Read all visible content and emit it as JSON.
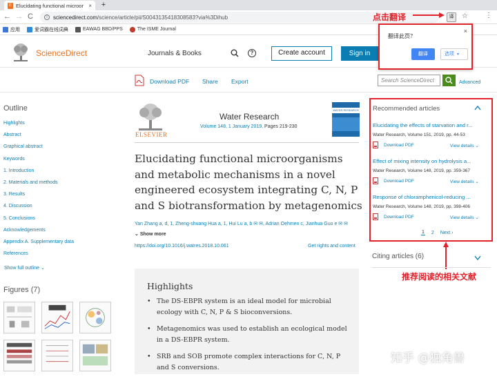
{
  "browser": {
    "tab_title": "Elucidating functional microor",
    "tab_close": "×",
    "new_tab": "+",
    "back": "←",
    "forward": "→",
    "reload": "C",
    "url_domain": "sciencedirect.com",
    "url_path": "/science/article/pii/S0043135418308583?via%3Dihub",
    "translate_icon": "译",
    "star": "☆",
    "menu": "⋮",
    "bookmarks": [
      {
        "label": "应用",
        "color": "#3c78d8"
      },
      {
        "label": "爱词霸在线词典",
        "color": "#2e8bdb"
      },
      {
        "label": "EAWAG BBD/PPS",
        "color": "#555555"
      },
      {
        "label": "The ISME Journal",
        "color": "#c0392b"
      }
    ]
  },
  "translate_popup": {
    "title": "翻译此页？",
    "close": "×",
    "translate_button": "翻译",
    "options_button": "选项"
  },
  "annotations": {
    "click_translate": "点击翻译",
    "recommended_note": "推荐阅读的相关文献",
    "watermark": "知乎 @独角兽"
  },
  "header": {
    "logo": "ScienceDirect",
    "journals_books": "Journals & Books",
    "create_account": "Create account",
    "sign_in": "Sign in"
  },
  "toolbar": {
    "download_pdf": "Download PDF",
    "share": "Share",
    "export": "Export",
    "search_placeholder": "Search ScienceDirect",
    "advanced": "Advanced"
  },
  "outline": {
    "title": "Outline",
    "items": [
      "Highlights",
      "Abstract",
      "Graphical abstract",
      "Keywords",
      "1. Introduction",
      "2. Materials and methods",
      "3. Results",
      "4. Discussion",
      "5. Conclusions",
      "Acknowledgements",
      "Appendix A. Supplementary data",
      "References"
    ],
    "show_full": "Show full outline",
    "figures_title": "Figures (7)"
  },
  "journal": {
    "publisher": "ELSEVIER",
    "name": "Water Research",
    "volume_info": "Volume 148, 1 January 2019,",
    "pages": "Pages 219-230",
    "cover_label": "WATER RESEARCH"
  },
  "article": {
    "title": "Elucidating functional microorganisms and metabolic mechanisms in a novel engineered ecosystem integrating C, N, P and S biotransformation by metagenomics",
    "authors": "Yan Zhang a, d, 1, Zheng-shuang Hua a, 1, Hui Lu a, b ✉ ✉, Adrian Oehmen c, Jianhua Guo e ✉ ✉",
    "show_more": "Show more",
    "doi": "https://doi.org/10.1016/j.watres.2018.10.061",
    "rights": "Get rights and content"
  },
  "highlights": {
    "title": "Highlights",
    "items": [
      "The DS-EBPR system is an ideal model for microbial ecology with C, N, P & S bioconversions.",
      "Metagenomics was used to establish an ecological model in a DS-EBPR system.",
      "SRB and SOB promote complex interactions for C, N, P and S conversions."
    ]
  },
  "recommended": {
    "title": "Recommended articles",
    "items": [
      {
        "title": "Elucidating the effects of starvation and r...",
        "meta": "Water Research, Volume 151, 2019, pp. 44-53",
        "pdf": "Download PDF",
        "view": "View details"
      },
      {
        "title": "Effect of mixing intensity on hydrolysis a...",
        "meta": "Water Research, Volume 148, 2019, pp. 359-367",
        "pdf": "Download PDF",
        "view": "View details"
      },
      {
        "title": "Response of chloramphenicol-reducing ...",
        "meta": "Water Research, Volume 148, 2019, pp. 398-406",
        "pdf": "Download PDF",
        "view": "View details"
      }
    ],
    "pages": [
      "1",
      "2"
    ],
    "next": "Next"
  },
  "citing": {
    "label": "Citing articles (6)"
  },
  "colors": {
    "brand_orange": "#e9711c",
    "link_blue": "#0c7db2",
    "annotation_red": "#e0232b"
  }
}
